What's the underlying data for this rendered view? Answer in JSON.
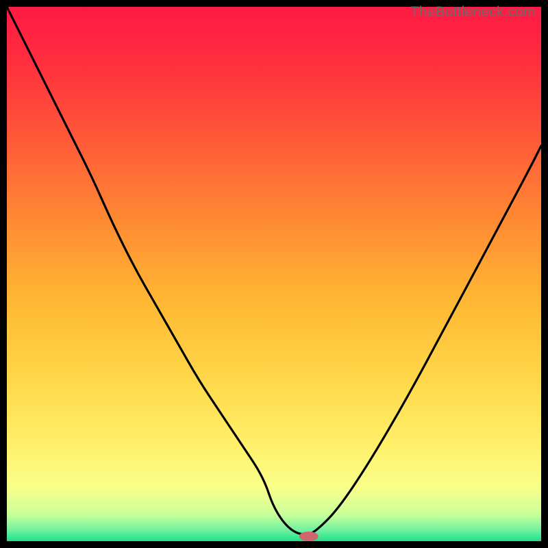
{
  "watermark": "TheBottleneck.com",
  "chart_data": {
    "type": "line",
    "title": "",
    "xlabel": "",
    "ylabel": "",
    "xlim": [
      0,
      100
    ],
    "ylim": [
      0,
      100
    ],
    "x": [
      0,
      4,
      8,
      12,
      16,
      20,
      24,
      28,
      32,
      36,
      40,
      44,
      48,
      50,
      53,
      56,
      58,
      62,
      68,
      75,
      82,
      90,
      98,
      100
    ],
    "values": [
      100,
      92,
      84,
      76,
      68,
      59,
      51,
      44,
      37,
      30,
      24,
      18,
      12,
      6,
      2,
      1,
      2,
      6,
      15,
      27,
      40,
      55,
      70,
      74
    ],
    "marker": {
      "x": 56.5,
      "y": 0.9,
      "color": "#d0666e",
      "rx": 14,
      "ry": 7
    },
    "gradient_stops": [
      {
        "offset": 0.0,
        "color": "#ff1a44"
      },
      {
        "offset": 0.1,
        "color": "#ff2e3e"
      },
      {
        "offset": 0.25,
        "color": "#ff5a38"
      },
      {
        "offset": 0.4,
        "color": "#ff8a33"
      },
      {
        "offset": 0.55,
        "color": "#ffb733"
      },
      {
        "offset": 0.7,
        "color": "#ffd84a"
      },
      {
        "offset": 0.82,
        "color": "#fff06a"
      },
      {
        "offset": 0.9,
        "color": "#faff8a"
      },
      {
        "offset": 0.95,
        "color": "#c9ff9a"
      },
      {
        "offset": 0.98,
        "color": "#6ef0a0"
      },
      {
        "offset": 1.0,
        "color": "#1fe08a"
      }
    ]
  }
}
